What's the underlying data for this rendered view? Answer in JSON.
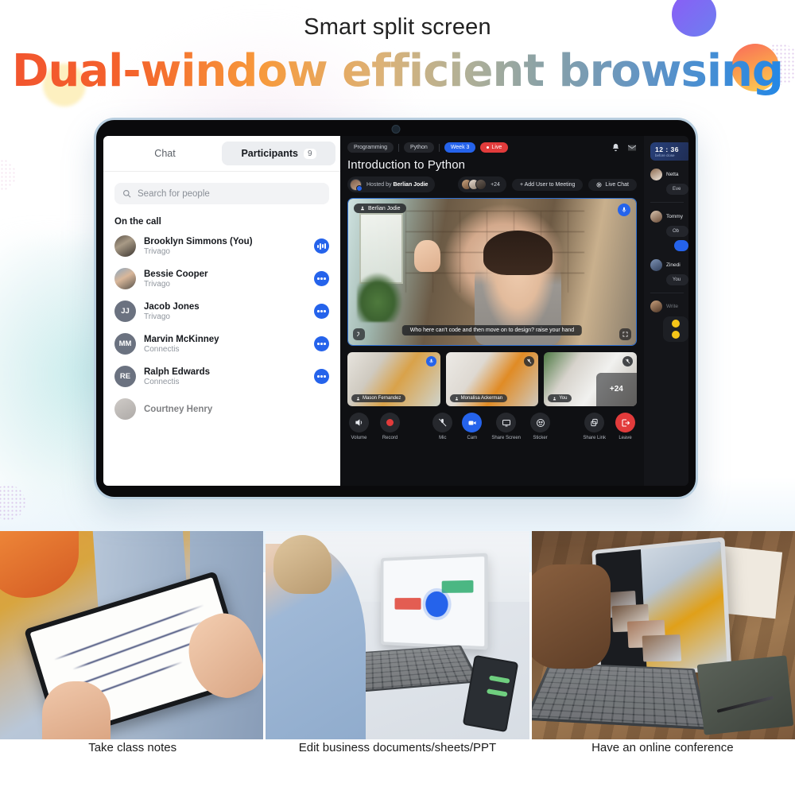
{
  "hero": {
    "subtitle": "Smart split screen",
    "title": "Dual-window efficient browsing"
  },
  "tablet": {
    "left_pane": {
      "tabs": [
        {
          "label": "Chat",
          "active": false
        },
        {
          "label": "Participants",
          "active": true,
          "badge": "9"
        }
      ],
      "search_placeholder": "Search for people",
      "section_title": "On the call",
      "participants": [
        {
          "name": "Brooklyn Simmons (You)",
          "org": "Trivago",
          "avatar_type": "photo",
          "initials": "",
          "action": "audio-level"
        },
        {
          "name": "Bessie Cooper",
          "org": "Trivago",
          "avatar_type": "photo",
          "initials": "",
          "action": "more"
        },
        {
          "name": "Jacob Jones",
          "org": "Trivago",
          "avatar_type": "initials",
          "initials": "JJ",
          "action": "more"
        },
        {
          "name": "Marvin McKinney",
          "org": "Connectis",
          "avatar_type": "initials",
          "initials": "MM",
          "action": "more"
        },
        {
          "name": "Ralph Edwards",
          "org": "Connectis",
          "avatar_type": "initials",
          "initials": "RE",
          "action": "more"
        },
        {
          "name": "Courtney Henry",
          "org": "",
          "avatar_type": "photo",
          "initials": "",
          "action": "more"
        }
      ]
    },
    "meeting": {
      "chips": [
        {
          "label": "Programming",
          "style": "dark"
        },
        {
          "label": "Python",
          "style": "dark"
        },
        {
          "label": "Week 3",
          "style": "blue"
        },
        {
          "label": "Live",
          "style": "red"
        }
      ],
      "title": "Introduction to Python",
      "host_prefix": "Hosted by",
      "host_name": "Berlian Jodie",
      "attendee_overflow": "+24",
      "add_user_label": "+ Add User to Meeting",
      "live_chat_label": "Live Chat",
      "stage": {
        "speaker_name": "Berlian Jodie",
        "caption": "Who here can't code and then move on to design? raise your hand"
      },
      "thumbnails": [
        {
          "name": "Mason Fernandez",
          "badge": "mic-on"
        },
        {
          "name": "Monalisa Ackerman",
          "badge": "mic-off"
        },
        {
          "name": "You",
          "badge": "mic-off",
          "overflow": "+24"
        }
      ],
      "toolbar": [
        {
          "label": "Volume",
          "icon": "volume-icon",
          "style": "dark"
        },
        {
          "label": "Record",
          "icon": "record-icon",
          "style": "dark"
        },
        {
          "label": "Mic",
          "icon": "mic-off-icon",
          "style": "dark"
        },
        {
          "label": "Cam",
          "icon": "camera-icon",
          "style": "blue"
        },
        {
          "label": "Share Screen",
          "icon": "screen-icon",
          "style": "dark"
        },
        {
          "label": "Sticker",
          "icon": "sticker-icon",
          "style": "dark"
        },
        {
          "label": "Share Link",
          "icon": "link-icon",
          "style": "dark"
        },
        {
          "label": "Leave",
          "icon": "leave-icon",
          "style": "red"
        }
      ]
    },
    "chat_rail": {
      "timer_value": "12 : 36",
      "timer_caption": "before close",
      "messages": [
        {
          "name": "Netta",
          "text": "Eve"
        },
        {
          "name": "Tommy",
          "text": "Ob"
        },
        {
          "name": "Zinedi",
          "text": "You"
        }
      ],
      "write_placeholder": "Write"
    }
  },
  "photos": [
    {
      "caption": "Take class notes"
    },
    {
      "caption": "Edit business documents/sheets/PPT"
    },
    {
      "caption": "Have an online conference"
    }
  ],
  "colors": {
    "accent_blue": "#2563eb",
    "danger_red": "#e23b3b",
    "headline_start": "#f2542f",
    "headline_end": "#1e86e8"
  }
}
